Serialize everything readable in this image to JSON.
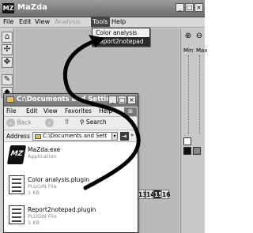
{
  "mazda": {
    "logo": "MZ",
    "title": "MaZda",
    "window_buttons": [
      "_",
      "□",
      "×"
    ],
    "menu": [
      "File",
      "Edit",
      "View",
      "Analysis",
      "Tools",
      "Help"
    ],
    "dropdown": {
      "items": [
        "Color analysis",
        "Report2notepad"
      ],
      "highlighted": "Report2notepad"
    },
    "toolbar_icons": [
      "open-icon",
      "move-icon",
      "pan-icon",
      "pen-icon",
      "fill-icon"
    ],
    "right_panel": {
      "labels": [
        "Min",
        "Max"
      ],
      "zoom_icons": [
        "zoom-in-icon",
        "zoom-out-icon"
      ]
    },
    "num_buttons": [
      "13",
      "14",
      "15",
      "16"
    ],
    "selected_num": "15"
  },
  "explorer": {
    "title": "C:\\Documents and Settings\\...",
    "window_buttons": [
      "_",
      "□",
      "×"
    ],
    "menu": [
      "File",
      "Edit",
      "View",
      "Favorites",
      "Help"
    ],
    "menu_more": "»",
    "nav": {
      "back": "Back",
      "search": "Search",
      "more": "»"
    },
    "address": {
      "label": "Address",
      "value": "C:\\Documents and Sett"
    },
    "go_more": "»",
    "files": [
      {
        "name": "MaZda.exe",
        "type": "Application",
        "size": "",
        "icon": "mazda-app-icon"
      },
      {
        "name": "Color analysis.plugin",
        "type": "PLUGIN File",
        "size": "1 KB",
        "icon": "plugin-file-icon"
      },
      {
        "name": "Report2notepad.plugin",
        "type": "PLUGIN File",
        "size": "1 KB",
        "icon": "plugin-file-icon"
      }
    ]
  },
  "colors": {
    "title_bar": "#6f6f6f",
    "highlight": "#2a2a2a",
    "window_bg": "#d4d0c8"
  }
}
